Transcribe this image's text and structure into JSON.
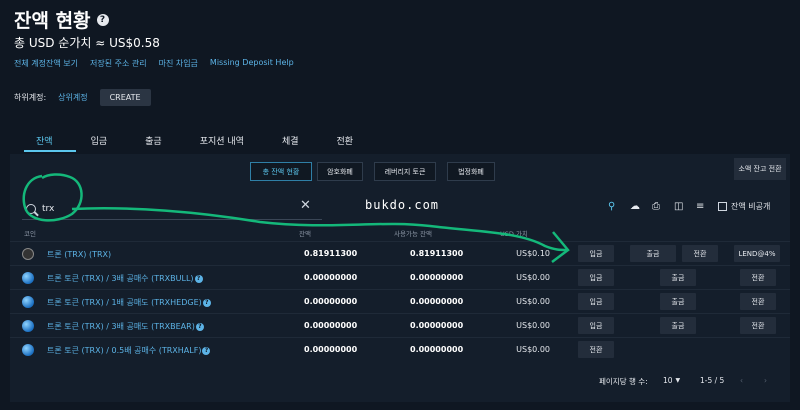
{
  "header": {
    "title": "잔액 현황",
    "net_value": "총 USD 순가치 ≈ US$0.58"
  },
  "links": [
    "전체 계정잔액 보기",
    "저장된 주소 관리",
    "마진 차입금",
    "Missing Deposit Help"
  ],
  "subaccount": {
    "label": "하위계정:",
    "parent": "상위계정",
    "create": "CREATE"
  },
  "tabs": [
    "잔액",
    "입금",
    "출금",
    "포지션 내역",
    "체결",
    "전환"
  ],
  "filters": [
    "총 잔액 현황",
    "암호화폐",
    "레버리지 토큰",
    "법정화폐"
  ],
  "small_convert": "소액 잔고 전환",
  "search": {
    "value": "trx"
  },
  "watermark": "bukdo.com",
  "hide_label": "잔액 비공개",
  "table": {
    "headers": {
      "coin": "코인",
      "total": "잔액",
      "available": "사용가능 잔액",
      "usd": "USD 가치"
    },
    "rows": [
      {
        "name": "트론 (TRX) (TRX)",
        "help": false,
        "icon": "trx",
        "total": "0.81911300",
        "available": "0.81911300",
        "usd": "US$0.10",
        "actions": [
          "입금",
          "출금",
          "전환",
          "LEND@4%"
        ]
      },
      {
        "name": "트론 토큰 (TRX) / 3배 공매수 (TRXBULL)",
        "help": true,
        "icon": "globe",
        "total": "0.00000000",
        "available": "0.00000000",
        "usd": "US$0.00",
        "actions": [
          "입금",
          "출금",
          "전환"
        ]
      },
      {
        "name": "트론 토큰 (TRX) / 1배 공매도 (TRXHEDGE)",
        "help": true,
        "icon": "globe",
        "total": "0.00000000",
        "available": "0.00000000",
        "usd": "US$0.00",
        "actions": [
          "입금",
          "출금",
          "전환"
        ]
      },
      {
        "name": "트론 토큰 (TRX) / 3배 공매도 (TRXBEAR)",
        "help": true,
        "icon": "globe",
        "total": "0.00000000",
        "available": "0.00000000",
        "usd": "US$0.00",
        "actions": [
          "입금",
          "출금",
          "전환"
        ]
      },
      {
        "name": "트론 토큰 (TRX) / 0.5배 공매수 (TRXHALF)",
        "help": true,
        "icon": "globe",
        "total": "0.00000000",
        "available": "0.00000000",
        "usd": "US$0.00",
        "actions": [
          "전환"
        ]
      }
    ]
  },
  "pager": {
    "rows_label": "페이지당 행 수:",
    "rows_value": "10",
    "range": "1-5 / 5"
  },
  "colors": {
    "accent": "#5cc7ee",
    "annotation": "#14b87a"
  }
}
